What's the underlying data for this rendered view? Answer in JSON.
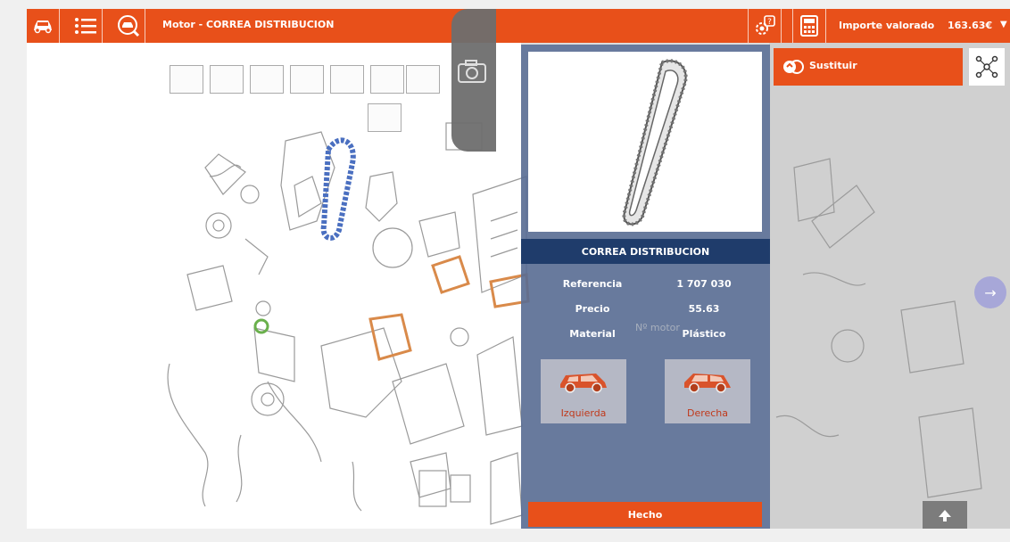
{
  "toolbar": {
    "title": "Motor - CORREA DISTRIBUCION",
    "importe_label": "Importe valorado",
    "importe_value": "163.63€",
    "icons": [
      "car-icon",
      "list-icon",
      "car-search-icon",
      "help-gear-icon",
      "calculator-icon",
      "caret-down-icon"
    ]
  },
  "panel": {
    "part_name": "CORREA DISTRIBUCION",
    "specs": [
      {
        "label": "Referencia",
        "value": "1 707 030"
      },
      {
        "label": "Precio",
        "value": "55.63"
      },
      {
        "label": "Material",
        "value": "Plástico"
      }
    ],
    "watermark": "Nº motor",
    "left_button": "Izquierda",
    "right_button": "Derecha",
    "done_button": "Hecho"
  },
  "actions": {
    "replace_label": "Sustituir"
  },
  "colors": {
    "accent": "#e8501a",
    "panel": "#586c94",
    "panel_header": "#1f3c6b",
    "highlight_blue": "#4a6fc0",
    "highlight_orange": "#d98a4a",
    "highlight_green": "#6ab04c"
  }
}
